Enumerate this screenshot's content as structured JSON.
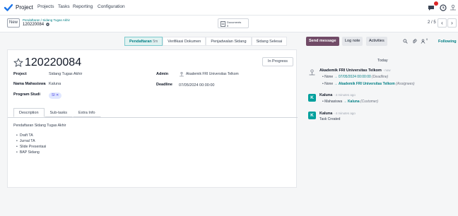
{
  "nav": {
    "brand": "Project",
    "menu": [
      "Projects",
      "Tasks",
      "Reporting",
      "Configuration"
    ]
  },
  "control": {
    "new_label": "New",
    "breadcrumb_parent": "Pendaftaran / Sidang Tugas Akhir",
    "breadcrumb_current": "120220084",
    "docs_label": "Documents",
    "docs_count": "0",
    "pager": "2 / 5"
  },
  "stages": {
    "active_label": "Pendaftaran",
    "active_count": "5m",
    "others": [
      "Verifikasi Dokumen",
      "Penjadwalan Sidang",
      "Sidang Selesai"
    ]
  },
  "form": {
    "title": "120220084",
    "state": "In Progress",
    "fields": {
      "project_label": "Project",
      "project_value": "Sidang Tugas Akhir",
      "nama_label": "Nama Mahasiswa",
      "nama_value": "Kaluna",
      "prodi_label": "Program Studi",
      "prodi_tag": "SI",
      "admin_label": "Admin",
      "admin_value": "Akademik FRI Universitas Telkom",
      "deadline_label": "Deadline",
      "deadline_value": "07/05/2024 00:00:00"
    },
    "tabs": [
      "Description",
      "Sub-tasks",
      "Extra Info"
    ],
    "description": "Pendaftaran Sidang Tugas Akhir",
    "bullets": [
      "Draft TA",
      "Jurnal TA",
      "Slide Presentasi",
      "BAP Sidang"
    ]
  },
  "chatter": {
    "send_message": "Send message",
    "log_note": "Log note",
    "activities": "Activities",
    "followers_count": "0",
    "following": "Following",
    "today": "Today",
    "messages": [
      {
        "author": "Akademik FRI Universitas Telkom",
        "time": "- now",
        "lines": [
          {
            "from": "None",
            "to": "07/05/2024 00:00:00",
            "field": "(Deadline)"
          },
          {
            "from": "None",
            "to": "Akademik FRI Universitas Telkom",
            "field": "(Assignees)"
          }
        ]
      },
      {
        "author": "Kaluna",
        "avatar": "K",
        "time": "- 4 minutes ago",
        "lines": [
          {
            "from": "Mahasiswa",
            "to": "Kaluna",
            "field": "(Customer)"
          }
        ]
      },
      {
        "author": "Kaluna",
        "avatar": "K",
        "time": "- 4 minutes ago",
        "text": "Task Created"
      }
    ]
  },
  "colors": {
    "brand": "#017e84",
    "send_message_bg": "#714b67",
    "avatar": "#00a09d",
    "badge": "#dc2626"
  }
}
